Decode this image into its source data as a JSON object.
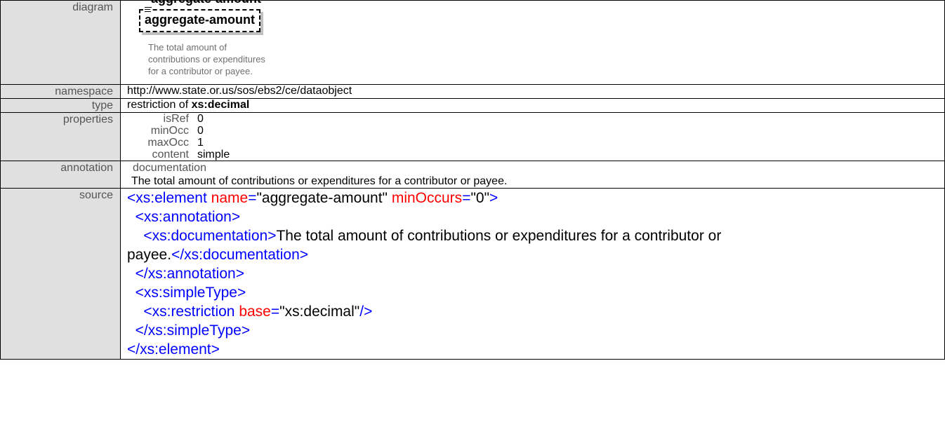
{
  "labels": {
    "diagram": "diagram",
    "namespace": "namespace",
    "type": "type",
    "properties": "properties",
    "annotation": "annotation",
    "source": "source"
  },
  "clipped_heading": "aggregate-amount",
  "diagram": {
    "element_name": "aggregate-amount",
    "note_lines": [
      "The total amount of",
      "contributions or expenditures",
      "for a contributor or payee."
    ]
  },
  "namespace": "http://www.state.or.us/sos/ebs2/ce/dataobject",
  "type": {
    "prefix": "restriction of ",
    "base": "xs:decimal"
  },
  "properties": [
    {
      "key": "isRef",
      "value": "0"
    },
    {
      "key": "minOcc",
      "value": "0"
    },
    {
      "key": "maxOcc",
      "value": "1"
    },
    {
      "key": "content",
      "value": "simple"
    }
  ],
  "annotation": {
    "label": "documentation",
    "text": "The total amount of contributions or expenditures for a contributor or payee."
  },
  "source": {
    "l1_open": "<xs:element",
    "l1_attr1": "name",
    "l1_val1": "\"aggregate-amount\"",
    "l1_attr2": "minOccurs",
    "l1_val2": "\"0\"",
    "l1_close": ">",
    "l2": "<xs:annotation>",
    "l3_open": "<xs:documentation>",
    "l3_text": "The total amount of contributions or expenditures for a contributor or",
    "l4_text": "payee.",
    "l4_close": "</xs:documentation>",
    "l5": "</xs:annotation>",
    "l6": "<xs:simpleType>",
    "l7_open": "<xs:restriction",
    "l7_attr": "base",
    "l7_val": "\"xs:decimal\"",
    "l7_close": "/>",
    "l8": "</xs:simpleType>",
    "l9": "</xs:element>"
  },
  "colors": {
    "label_bg": "#e0e0e0",
    "tag": "#0000ff",
    "attr": "#ff0000"
  }
}
